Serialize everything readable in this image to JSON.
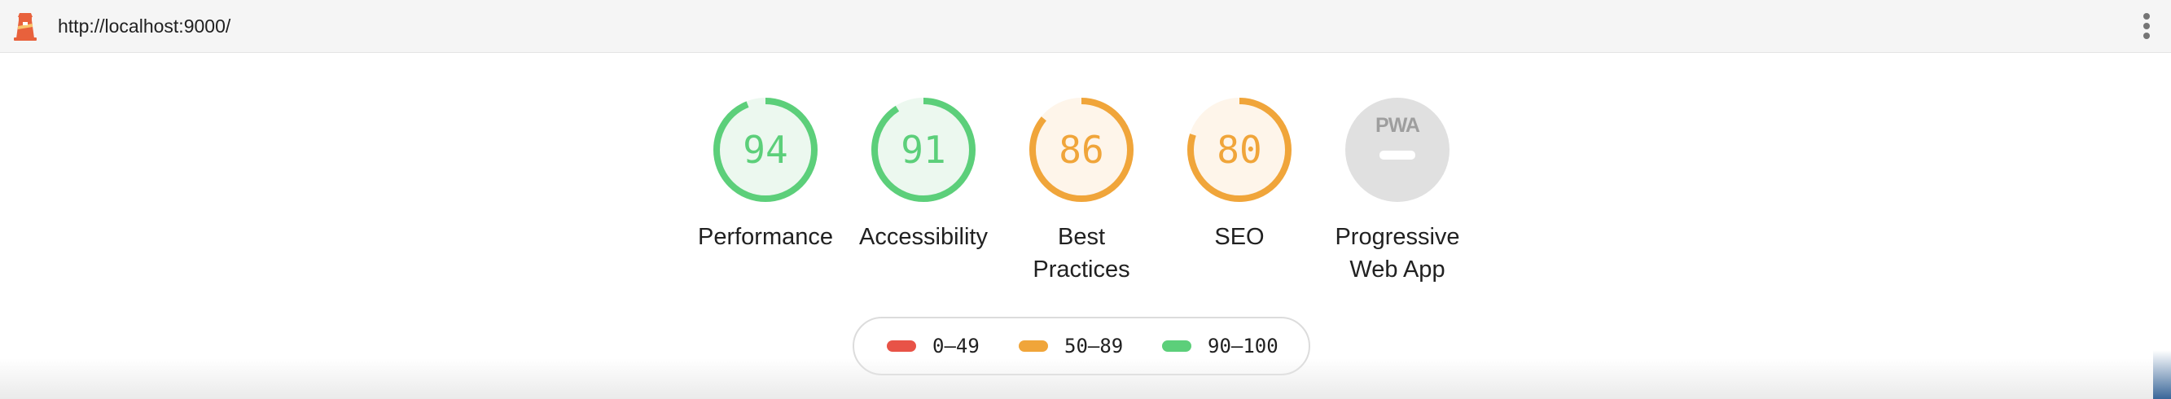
{
  "topbar": {
    "url": "http://localhost:9000/",
    "logo_icon": "lighthouse-icon",
    "menu_icon": "more-vertical-icon"
  },
  "colors": {
    "pass": "#5ccf7a",
    "pass_fill": "#ecf8ef",
    "average": "#f0a53a",
    "average_fill": "#fef5ea",
    "fail": "#e85347",
    "na": "#e0e0e0"
  },
  "gauges": [
    {
      "value": "94",
      "label": "Performance",
      "score": 94,
      "rating": "pass"
    },
    {
      "value": "91",
      "label": "Accessibility",
      "score": 91,
      "rating": "pass"
    },
    {
      "value": "86",
      "label": "Best Practices",
      "score": 86,
      "rating": "average"
    },
    {
      "value": "80",
      "label": "SEO",
      "score": 80,
      "rating": "average"
    },
    {
      "value": "",
      "label": "Progressive Web App",
      "badge": "PWA",
      "rating": "na"
    }
  ],
  "legend": [
    {
      "range": "0–49",
      "rating": "fail"
    },
    {
      "range": "50–89",
      "rating": "average"
    },
    {
      "range": "90–100",
      "rating": "pass"
    }
  ]
}
